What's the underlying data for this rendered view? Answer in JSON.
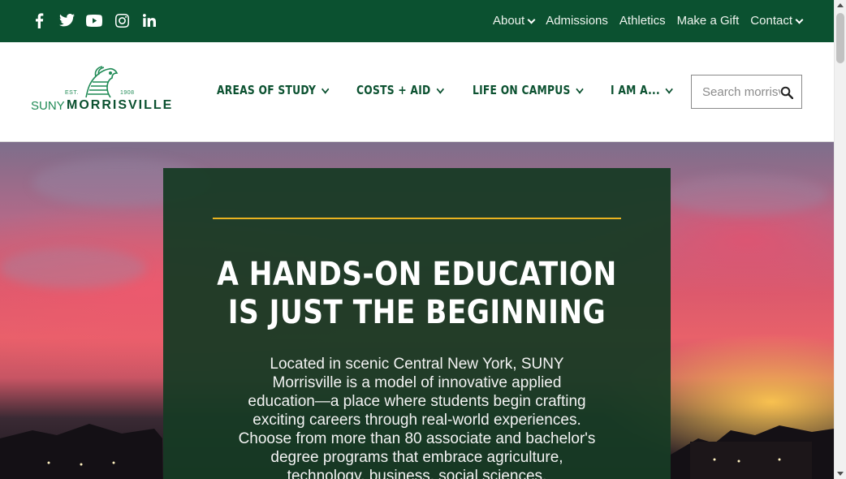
{
  "topbar": {
    "background_color": "#0b5130",
    "social": [
      {
        "name": "facebook",
        "icon": "facebook-icon"
      },
      {
        "name": "twitter",
        "icon": "twitter-icon"
      },
      {
        "name": "youtube",
        "icon": "youtube-icon"
      },
      {
        "name": "instagram",
        "icon": "instagram-icon"
      },
      {
        "name": "linkedin",
        "icon": "linkedin-icon"
      }
    ],
    "links": [
      {
        "label": "About",
        "has_dropdown": true
      },
      {
        "label": "Admissions",
        "has_dropdown": false
      },
      {
        "label": "Athletics",
        "has_dropdown": false
      },
      {
        "label": "Make a Gift",
        "has_dropdown": false
      },
      {
        "label": "Contact",
        "has_dropdown": true
      }
    ]
  },
  "logo": {
    "est": "EST.",
    "year": "1908",
    "suny": "SUNY",
    "name": "MORRISVILLE",
    "icon": "mustang-horse-icon"
  },
  "mainnav": {
    "items": [
      {
        "label": "AREAS OF STUDY"
      },
      {
        "label": "COSTS + AID"
      },
      {
        "label": "LIFE ON CAMPUS"
      },
      {
        "label": "I AM A..."
      }
    ]
  },
  "search": {
    "placeholder": "Search morrisville.edu",
    "icon": "search-icon"
  },
  "hero": {
    "title_line1": "A HANDS-ON EDUCATION",
    "title_line2": "IS JUST THE BEGINNING",
    "body": "Located in scenic Central New York, SUNY Morrisville is a model of innovative applied education—a place where students begin crafting exciting careers through real-world experiences. Choose from more than 80 associate and bachelor's degree programs that embrace agriculture, technology, business, social sciences,",
    "accent_color": "#e9b320"
  }
}
